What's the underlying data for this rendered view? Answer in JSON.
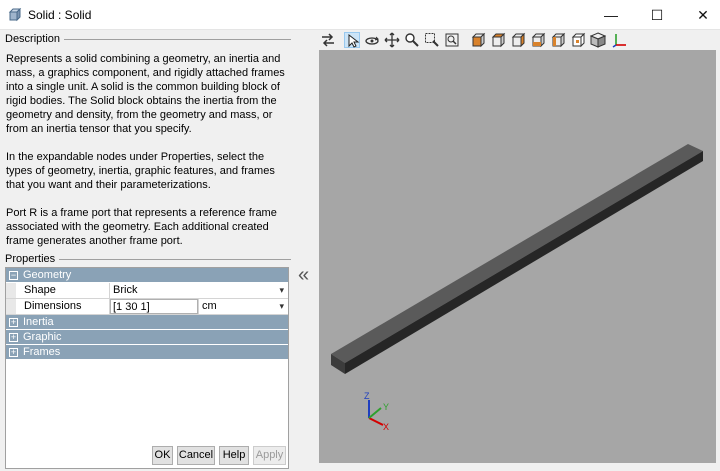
{
  "window": {
    "title": "Solid : Solid",
    "min_glyph": "—",
    "max_glyph": "☐",
    "close_glyph": "✕"
  },
  "description": {
    "header": "Description",
    "paragraphs": [
      "Represents a solid combining a geometry, an inertia and mass, a graphics component, and rigidly attached frames into a single unit. A solid is the common building block of rigid bodies. The Solid block obtains the inertia from the geometry and density, from the geometry and mass, or from an inertia tensor that you specify.",
      "In the expandable nodes under Properties, select the types of geometry, inertia, graphic features, and frames that you want and their parameterizations.",
      "Port R is a frame port that represents a reference frame associated with the geometry. Each additional created frame generates another frame port."
    ]
  },
  "properties": {
    "header": "Properties",
    "groups": [
      {
        "label": "Geometry",
        "expanded": true
      },
      {
        "label": "Inertia",
        "expanded": false
      },
      {
        "label": "Graphic",
        "expanded": false
      },
      {
        "label": "Frames",
        "expanded": false
      }
    ],
    "shape": {
      "label": "Shape",
      "value": "Brick"
    },
    "dimensions": {
      "label": "Dimensions",
      "value": "[1 30 1]",
      "unit": "cm"
    },
    "expanded_glyph": "−",
    "collapsed_glyph": "+",
    "dropdown_glyph": "▾"
  },
  "buttons": {
    "ok": "OK",
    "cancel": "Cancel",
    "help": "Help",
    "apply": "Apply"
  },
  "splitter": {
    "glyph": "«"
  },
  "viewer": {
    "triad": {
      "x": "X",
      "y": "Y",
      "z": "Z"
    },
    "colors": {
      "background": "#a6a6a6",
      "x_axis": "#d40000",
      "y_axis": "#2ea02e",
      "z_axis": "#1f3fbf"
    }
  },
  "toolbar_icons": [
    "toggle-visibility-icon",
    "select-icon",
    "rotate-icon",
    "pan-icon",
    "zoom-icon",
    "zoom-box-icon",
    "fit-view-icon",
    "front-view-icon",
    "back-view-icon",
    "left-view-icon",
    "right-view-icon",
    "top-view-icon",
    "bottom-view-icon",
    "isometric-view-icon",
    "frame-triad-icon"
  ]
}
